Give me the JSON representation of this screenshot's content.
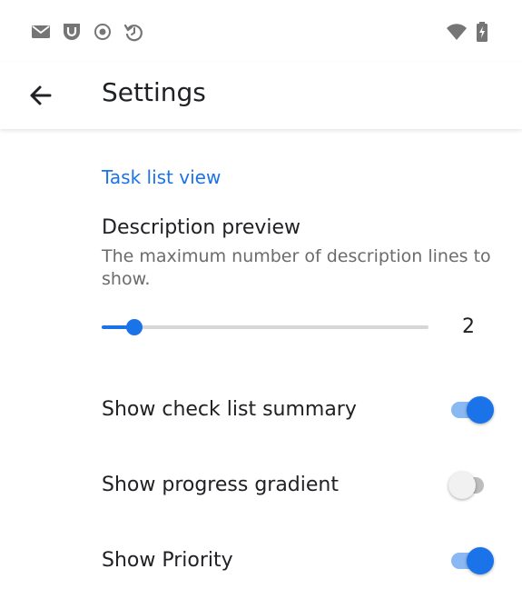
{
  "status_bar": {
    "left_icons": [
      "mail-icon",
      "shield-app-icon",
      "record-icon",
      "sync-history-icon"
    ],
    "right_icons": [
      "wifi-icon",
      "battery-charging-icon"
    ]
  },
  "app_bar": {
    "back_icon": "arrow-back-icon",
    "title": "Settings"
  },
  "sections": [
    {
      "header": "Task list view",
      "description_preview": {
        "title": "Description preview",
        "summary": "The maximum number of description lines to show.",
        "value": "2",
        "slider_fraction": 0.1
      },
      "toggles": [
        {
          "label": "Show check list summary",
          "checked": true
        },
        {
          "label": "Show progress gradient",
          "checked": false
        },
        {
          "label": "Show Priority",
          "checked": true
        }
      ]
    }
  ],
  "colors": {
    "accent": "#1a73e8",
    "accent_light": "#8ab8f3",
    "status_icon": "#757575",
    "text_primary": "#202124",
    "text_secondary": "#6b6b6b"
  }
}
